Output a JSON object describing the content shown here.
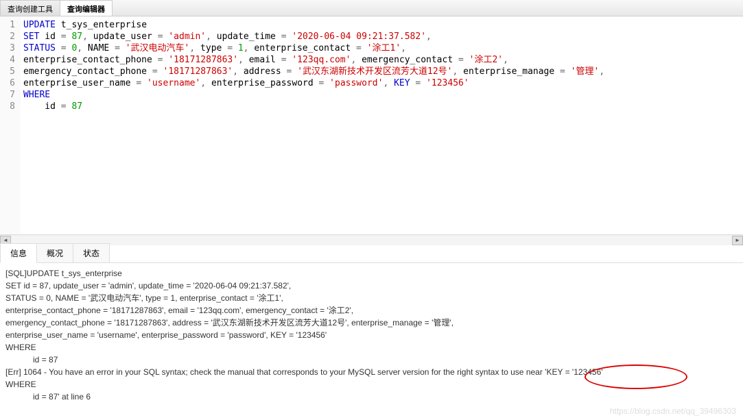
{
  "topTabs": [
    {
      "label": "查询创建工具",
      "active": false
    },
    {
      "label": "查询编辑器",
      "active": true
    }
  ],
  "editor": {
    "lines": [
      {
        "num": "1",
        "tokens": [
          [
            "kw",
            "UPDATE"
          ],
          [
            "id",
            " t_sys_enterprise"
          ]
        ]
      },
      {
        "num": "2",
        "tokens": [
          [
            "kw",
            "SET"
          ],
          [
            "id",
            " id "
          ],
          [
            "op",
            "="
          ],
          [
            "id",
            " "
          ],
          [
            "num",
            "87"
          ],
          [
            "op",
            ","
          ],
          [
            "id",
            " update_user "
          ],
          [
            "op",
            "="
          ],
          [
            "id",
            " "
          ],
          [
            "str",
            "'admin'"
          ],
          [
            "op",
            ","
          ],
          [
            "id",
            " update_time "
          ],
          [
            "op",
            "="
          ],
          [
            "id",
            " "
          ],
          [
            "str",
            "'2020-06-04 09:21:37.582'"
          ],
          [
            "op",
            ","
          ]
        ]
      },
      {
        "num": "3",
        "tokens": [
          [
            "kw",
            "STATUS"
          ],
          [
            "id",
            " "
          ],
          [
            "op",
            "="
          ],
          [
            "id",
            " "
          ],
          [
            "num",
            "0"
          ],
          [
            "op",
            ","
          ],
          [
            "id",
            " NAME "
          ],
          [
            "op",
            "="
          ],
          [
            "id",
            " "
          ],
          [
            "str",
            "'武汉电动汽车'"
          ],
          [
            "op",
            ","
          ],
          [
            "id",
            " type "
          ],
          [
            "op",
            "="
          ],
          [
            "id",
            " "
          ],
          [
            "num",
            "1"
          ],
          [
            "op",
            ","
          ],
          [
            "id",
            " enterprise_contact "
          ],
          [
            "op",
            "="
          ],
          [
            "id",
            " "
          ],
          [
            "str",
            "'涂工1'"
          ],
          [
            "op",
            ","
          ]
        ]
      },
      {
        "num": "4",
        "tokens": [
          [
            "id",
            "enterprise_contact_phone "
          ],
          [
            "op",
            "="
          ],
          [
            "id",
            " "
          ],
          [
            "str",
            "'18171287863'"
          ],
          [
            "op",
            ","
          ],
          [
            "id",
            " email "
          ],
          [
            "op",
            "="
          ],
          [
            "id",
            " "
          ],
          [
            "str",
            "'123qq.com'"
          ],
          [
            "op",
            ","
          ],
          [
            "id",
            " emergency_contact "
          ],
          [
            "op",
            "="
          ],
          [
            "id",
            " "
          ],
          [
            "str",
            "'涂工2'"
          ],
          [
            "op",
            ","
          ]
        ]
      },
      {
        "num": "5",
        "tokens": [
          [
            "id",
            "emergency_contact_phone "
          ],
          [
            "op",
            "="
          ],
          [
            "id",
            " "
          ],
          [
            "str",
            "'18171287863'"
          ],
          [
            "op",
            ","
          ],
          [
            "id",
            " address "
          ],
          [
            "op",
            "="
          ],
          [
            "id",
            " "
          ],
          [
            "str",
            "'武汉东湖新技术开发区流芳大道12号'"
          ],
          [
            "op",
            ","
          ],
          [
            "id",
            " enterprise_manage "
          ],
          [
            "op",
            "="
          ],
          [
            "id",
            " "
          ],
          [
            "str",
            "'管理'"
          ],
          [
            "op",
            ","
          ]
        ]
      },
      {
        "num": "6",
        "tokens": [
          [
            "id",
            "enterprise_user_name "
          ],
          [
            "op",
            "="
          ],
          [
            "id",
            " "
          ],
          [
            "str",
            "'username'"
          ],
          [
            "op",
            ","
          ],
          [
            "id",
            " enterprise_password "
          ],
          [
            "op",
            "="
          ],
          [
            "id",
            " "
          ],
          [
            "str",
            "'password'"
          ],
          [
            "op",
            ","
          ],
          [
            "id",
            " "
          ],
          [
            "kw",
            "KEY"
          ],
          [
            "id",
            " "
          ],
          [
            "op",
            "="
          ],
          [
            "id",
            " "
          ],
          [
            "str",
            "'123456'"
          ]
        ]
      },
      {
        "num": "7",
        "tokens": [
          [
            "kw",
            "WHERE"
          ]
        ]
      },
      {
        "num": "8",
        "tokens": [
          [
            "id",
            "    id "
          ],
          [
            "op",
            "="
          ],
          [
            "id",
            " "
          ],
          [
            "num",
            "87"
          ]
        ]
      }
    ]
  },
  "bottomTabs": [
    {
      "label": "信息",
      "active": true
    },
    {
      "label": "概况",
      "active": false
    },
    {
      "label": "状态",
      "active": false
    }
  ],
  "output": [
    "[SQL]UPDATE t_sys_enterprise",
    "SET id = 87, update_user = 'admin', update_time = '2020-06-04 09:21:37.582',",
    "STATUS = 0, NAME = '武汉电动汽车', type = 1, enterprise_contact = '涂工1',",
    "enterprise_contact_phone = '18171287863', email = '123qq.com', emergency_contact = '涂工2',",
    "emergency_contact_phone = '18171287863', address = '武汉东湖新技术开发区流芳大道12号', enterprise_manage = '管理',",
    "enterprise_user_name = 'username', enterprise_password = 'password', KEY = '123456'",
    "WHERE",
    "            id = 87",
    "",
    "[Err] 1064 - You have an error in your SQL syntax; check the manual that corresponds to your MySQL server version for the right syntax to use near 'KEY = '123456'",
    "WHERE",
    "            id = 87' at line 6"
  ],
  "watermark": "https://blog.csdn.net/qq_39496303"
}
